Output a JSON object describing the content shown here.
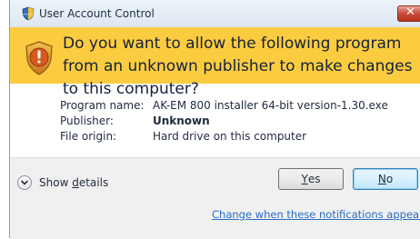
{
  "window": {
    "title": "User Account Control",
    "close_label": "✕"
  },
  "banner": {
    "message": "Do you want to allow the following program from an unknown publisher to make changes to this computer?",
    "background_color": "#fbcc40",
    "icon": "warning-shield-icon"
  },
  "details": {
    "program_name_label": "Program name:",
    "program_name_value": "AK-EM 800 installer 64-bit version-1.30.exe",
    "publisher_label": "Publisher:",
    "publisher_value": "Unknown",
    "file_origin_label": "File origin:",
    "file_origin_value": "Hard drive on this computer"
  },
  "footer": {
    "show_details_prefix": "Show ",
    "show_details_accel": "d",
    "show_details_suffix": "etails",
    "yes_accel": "Y",
    "yes_suffix": "es",
    "no_accel": "N",
    "no_suffix": "o",
    "notifications_link": "Change when these notifications appear",
    "link_color": "#2a6cc4"
  }
}
